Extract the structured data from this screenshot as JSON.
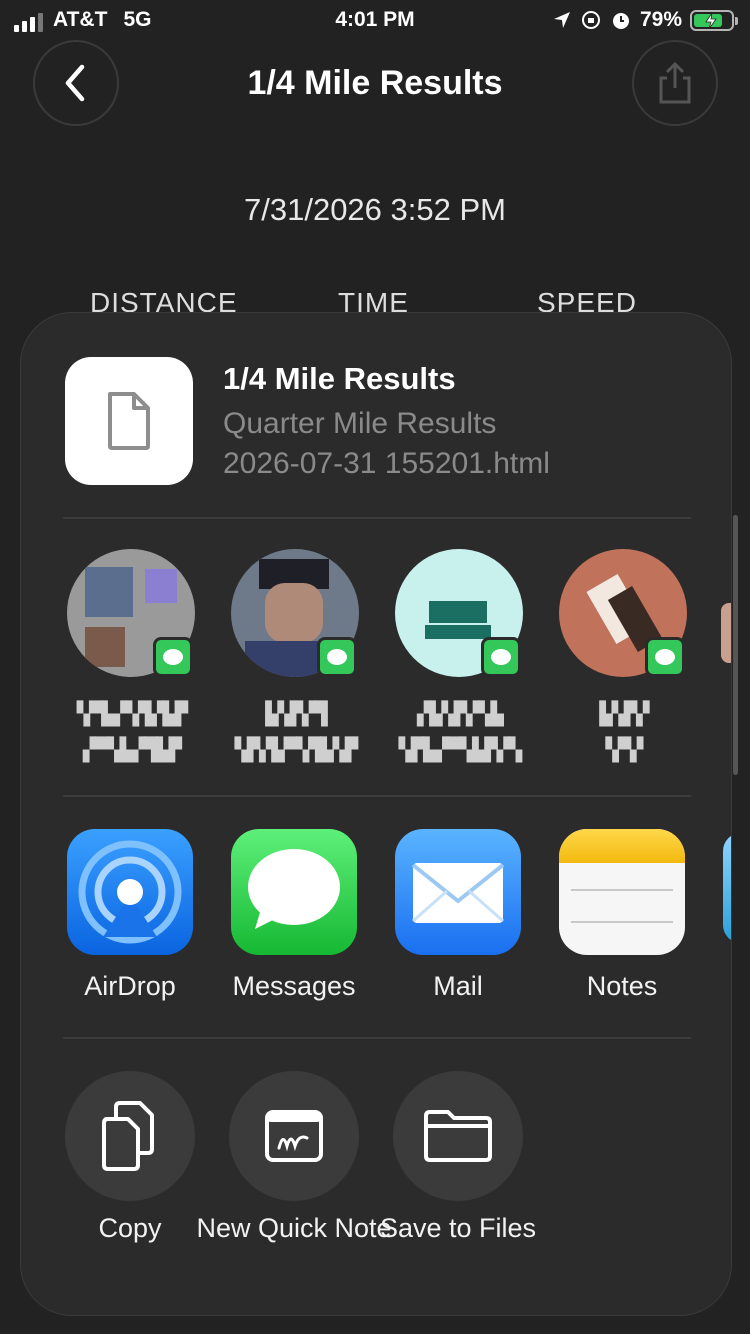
{
  "status_bar": {
    "carrier": "AT&T",
    "network": "5G",
    "time": "4:01 PM",
    "battery": "79%",
    "battery_level": 0.79
  },
  "nav": {
    "title": "1/4 Mile Results",
    "back_icon": "chevron-left-icon",
    "share_icon": "share-icon"
  },
  "page": {
    "date": "7/31/2026 3:52 PM",
    "columns": [
      "DISTANCE",
      "TIME",
      "SPEED"
    ]
  },
  "share_sheet": {
    "file_title": "1/4 Mile Results",
    "file_subtitle_1": "Quarter Mile Results",
    "file_subtitle_2": "2026-07-31 155201.html",
    "contacts": [
      {
        "line1": "▚▀▙▞▚▜▞▙▛",
        "line2": "▞▀▚▙▞▜▙▛"
      },
      {
        "line1": "▙▚▛▞▜",
        "line2": "▚▛▞▙▀▚▜▙▚▛"
      },
      {
        "line1": "▞▙▚▛▞▚▙",
        "line2": "▚▛▙▞▀▚▙▛▞▚"
      },
      {
        "line1": "▙▚▛▞",
        "line2": "▚▀▞"
      }
    ],
    "apps": [
      {
        "label": "AirDrop",
        "icon": "airdrop-icon"
      },
      {
        "label": "Messages",
        "icon": "messages-icon"
      },
      {
        "label": "Mail",
        "icon": "mail-icon"
      },
      {
        "label": "Notes",
        "icon": "notes-icon"
      }
    ],
    "actions": [
      {
        "label": "Copy",
        "icon": "copy-icon"
      },
      {
        "label": "New Quick Note",
        "icon": "quick-note-icon"
      },
      {
        "label": "Save to Files",
        "icon": "folder-icon"
      }
    ],
    "colors": {
      "sheet_bg": "#2b2b2b",
      "messages_green": "#34c759",
      "airdrop_blue": "#1a73e8",
      "notes_yellow": "#f5c518"
    }
  }
}
